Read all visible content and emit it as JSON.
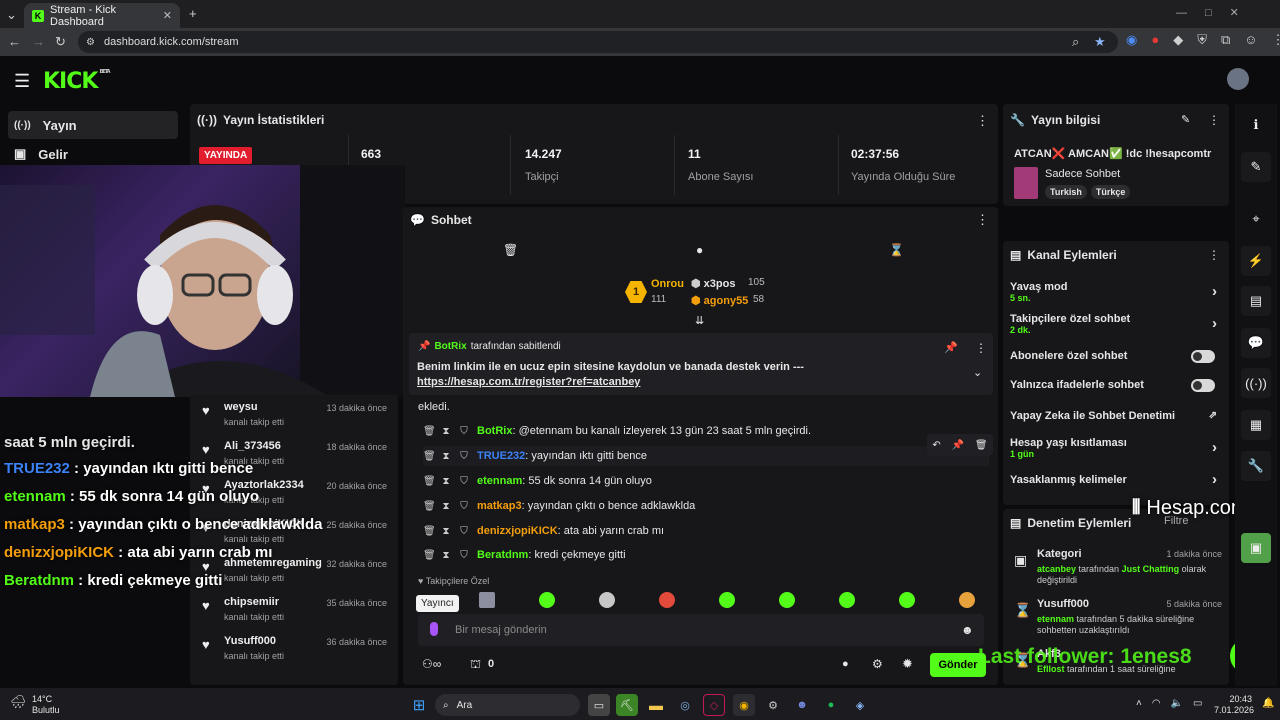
{
  "browser": {
    "tab_title": "Stream - Kick Dashboard",
    "url": "dashboard.kick.com/stream"
  },
  "app": {
    "logo": "KICK",
    "logo_badge": "BETA"
  },
  "sidebar": [
    {
      "label": "Yayın",
      "icon": "broadcast-icon"
    },
    {
      "label": "Gelir",
      "icon": "wallet-icon"
    }
  ],
  "stats": {
    "title": "Yayın İstatistikleri",
    "live_badge": "YAYINDA",
    "viewers": "663",
    "followers_value": "14.247",
    "followers_label": "Takipçi",
    "subs_value": "11",
    "subs_label": "Abone Sayısı",
    "duration_value": "02:37:56",
    "duration_label": "Yayında Olduğu Süre"
  },
  "chat": {
    "title": "Sohbet",
    "leaderboard": {
      "first_name": "Onrou",
      "first_value": "111",
      "second_name": "x3pos",
      "second_value": "105",
      "third_name": "agony55",
      "third_value": "58"
    },
    "pinned": {
      "pinned_by": "BotRix",
      "pinned_suffix": "tarafından sabitlendi",
      "text": "Benim linkim ile en ucuz epin sitesine kaydolun ve banada destek verin --- ",
      "link": "https://hesap.com.tr/register?ref=atcanbey"
    },
    "partial_line": "ekledi.",
    "messages": [
      {
        "user": "BotRix",
        "color": "#53fc18",
        "text": ": @etennam bu kanalı izleyerek 13 gün 23 saat 5 mln geçirdi."
      },
      {
        "user": "TRUE232",
        "color": "#3b82f6",
        "text": ": yayından ıktı gitti bence"
      },
      {
        "user": "etennam",
        "color": "#53fc18",
        "text": ": 55 dk sonra 14 gün oluyo"
      },
      {
        "user": "matkap3",
        "color": "#f59e0b",
        "text": ": yayından çıktı o bence adklawklda"
      },
      {
        "user": "denizxjopiKICK",
        "color": "#f59e0b",
        "text": ": ata abi yarın crab mı"
      },
      {
        "user": "Beratdnm",
        "color": "#53fc18",
        "text": ": kredi çekmeye gitti"
      }
    ],
    "followers_only": "Takipçilere Özel",
    "tooltip": "Yayıncı",
    "input_placeholder": "Bir mesaj gönderin",
    "points": "0",
    "send_label": "Gönder"
  },
  "followers": [
    {
      "name": "weysu",
      "sub": "kanalı takip etti",
      "time": "13 dakika önce"
    },
    {
      "name": "Ali_373456",
      "sub": "kanalı takip etti",
      "time": "18 dakika önce"
    },
    {
      "name": "Ayaztorlak2334",
      "sub": "kanalı takip etti",
      "time": "20 dakika önce"
    },
    {
      "name": "denizxjopiKICK",
      "sub": "kanalı takip etti",
      "time": "25 dakika önce"
    },
    {
      "name": "ahmetemregaming",
      "sub": "kanalı takip etti",
      "time": "32 dakika önce"
    },
    {
      "name": "chipsemiir",
      "sub": "kanalı takip etti",
      "time": "35 dakika önce"
    },
    {
      "name": "Yusuff000",
      "sub": "kanalı takip etti",
      "time": "36 dakika önce"
    }
  ],
  "overlay": {
    "top_partial": "saat 5 mln geçirdi.",
    "lines": [
      {
        "user": "TRUE232",
        "text": " : yayından ıktı gitti bence",
        "color": "#3b82f6"
      },
      {
        "user": "etennam",
        "text": " : 55 dk sonra 14 gün oluyo",
        "color": "#53fc18"
      },
      {
        "user": "matkap3",
        "text": " : yayından çıktı o bence adklawklda",
        "color": "#f59e0b"
      },
      {
        "user": "denizxjopiKICK",
        "text": " : ata abi yarın crab mı",
        "color": "#f59e0b"
      },
      {
        "user": "Beratdnm",
        "text": " : kredi çekmeye gitti",
        "color": "#53fc18"
      }
    ],
    "brand": "Hesap.com.tr",
    "last_follower": "Last follower: 1enes8"
  },
  "stream_info": {
    "title": "Yayın bilgisi",
    "stream_title": "ATCAN❌ AMCAN✅ !dc !hesapcomtr",
    "category": "Sadece Sohbet",
    "tags": [
      "Turkish",
      "Türkçe"
    ]
  },
  "channel_actions": {
    "title": "Kanal Eylemleri",
    "slow_mode": "Yavaş mod",
    "slow_value": "5 sn.",
    "followers_chat": "Takipçilere özel sohbet",
    "followers_value": "2 dk.",
    "subs_chat": "Abonelere özel sohbet",
    "emote_chat": "Yalnızca ifadelerle sohbet",
    "ai_mod": "Yapay Zeka ile Sohbet Denetimi",
    "age": "Hesap yaşı kısıtlaması",
    "age_value": "1 gün",
    "banned_words": "Yasaklanmış kelimeler"
  },
  "mod_actions": {
    "title": "Denetim Eylemleri",
    "filter": "Filtre",
    "items": [
      {
        "title": "Kategori",
        "time": "1 dakika önce",
        "actor": "atcanbey",
        "mid": " tarafından ",
        "target": "Just Chatting",
        "rest": " olarak değiştirildi"
      },
      {
        "title": "Yusuff000",
        "time": "5 dakika önce",
        "actor": "etennam",
        "rest": " tarafından 5 dakika süreliğine sohbetten uzaklaştırıldı"
      },
      {
        "title": "Akf3",
        "time": "",
        "actor": "Efllost",
        "rest": " tarafından 1 saat süreliğine"
      }
    ]
  },
  "taskbar": {
    "temp": "14°C",
    "weather": "Bulutlu",
    "search": "Ara",
    "time": "20:43",
    "date": "7.01.2026"
  }
}
